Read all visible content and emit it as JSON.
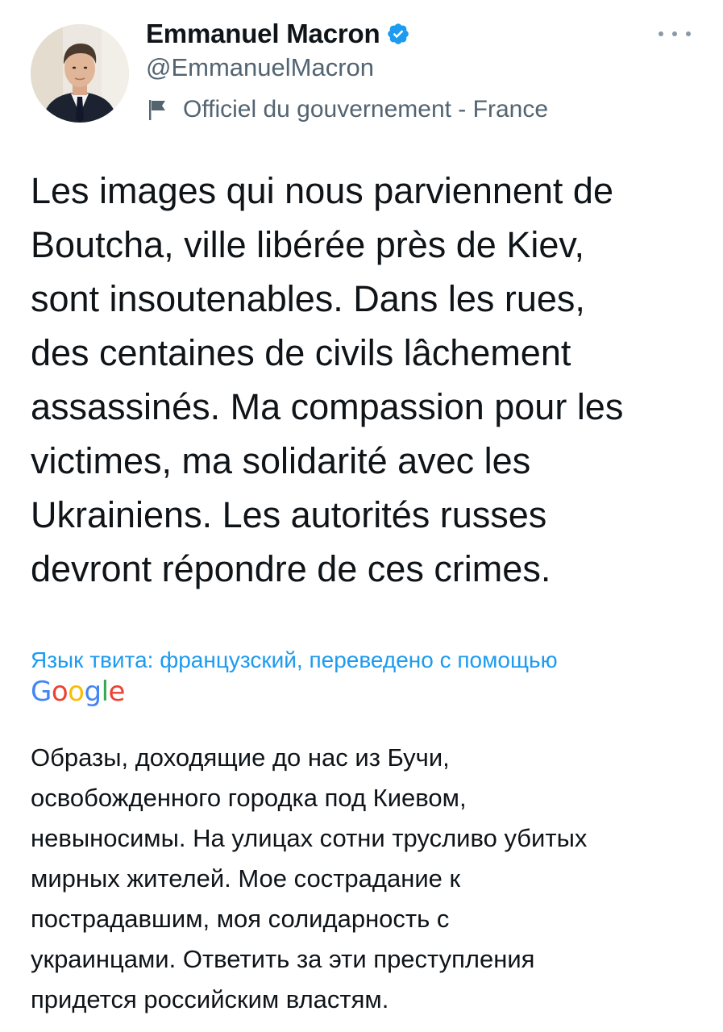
{
  "author": {
    "name": "Emmanuel Macron",
    "handle": "@EmmanuelMacron",
    "verified_icon": "verified-badge-icon",
    "affiliation_icon": "flag-icon",
    "affiliation": "Officiel du gouvernement - France"
  },
  "more_icon": "more-options-icon",
  "tweet": {
    "text": "Les images qui nous parviennent de\nBoutcha, ville libérée près de Kiev,\nsont insoutenables. Dans les rues,\ndes centaines de civils lâchement\nassassinés. Ma compassion pour les\nvictimes, ma solidarité avec les\nUkrainiens. Les autorités russes\ndevront répondre de ces crimes."
  },
  "translation": {
    "note": "Язык твита: французский, переведено с помощью",
    "provider_letters": [
      "G",
      "o",
      "o",
      "g",
      "l",
      "e"
    ],
    "text": "Образы, доходящие до нас из Бучи,\nосвобожденного городка под Киевом,\nневыносимы. На улицах сотни трусливо убитых\nмирных жителей. Мое сострадание к\nпострадавшим, моя солидарность с\nукраинцами. Ответить за эти преступления\nпридется российским властям."
  },
  "colors": {
    "verified": "#1d9bf0",
    "link": "#1d9bf0",
    "secondary_text": "#536471",
    "primary_text": "#0f1419"
  }
}
